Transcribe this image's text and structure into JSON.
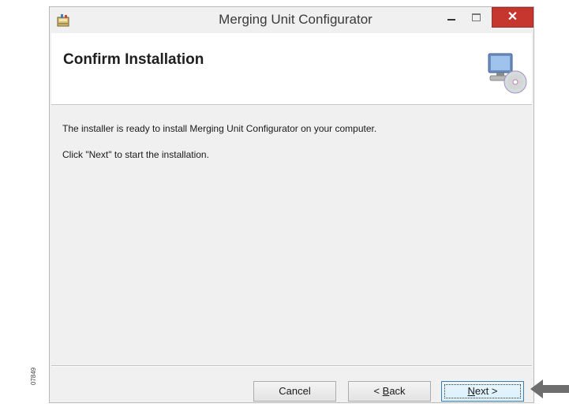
{
  "window": {
    "title": "Merging Unit Configurator",
    "close_glyph": "✕"
  },
  "header": {
    "title": "Confirm Installation"
  },
  "body": {
    "line1": "The installer is ready to install Merging Unit Configurator on your computer.",
    "line2": "Click \"Next\" to start the installation."
  },
  "buttons": {
    "cancel": "Cancel",
    "back_prefix": "< ",
    "back_mnemonic": "B",
    "back_rest": "ack",
    "next_mnemonic": "N",
    "next_rest": "ext >"
  },
  "side_code": "07849"
}
